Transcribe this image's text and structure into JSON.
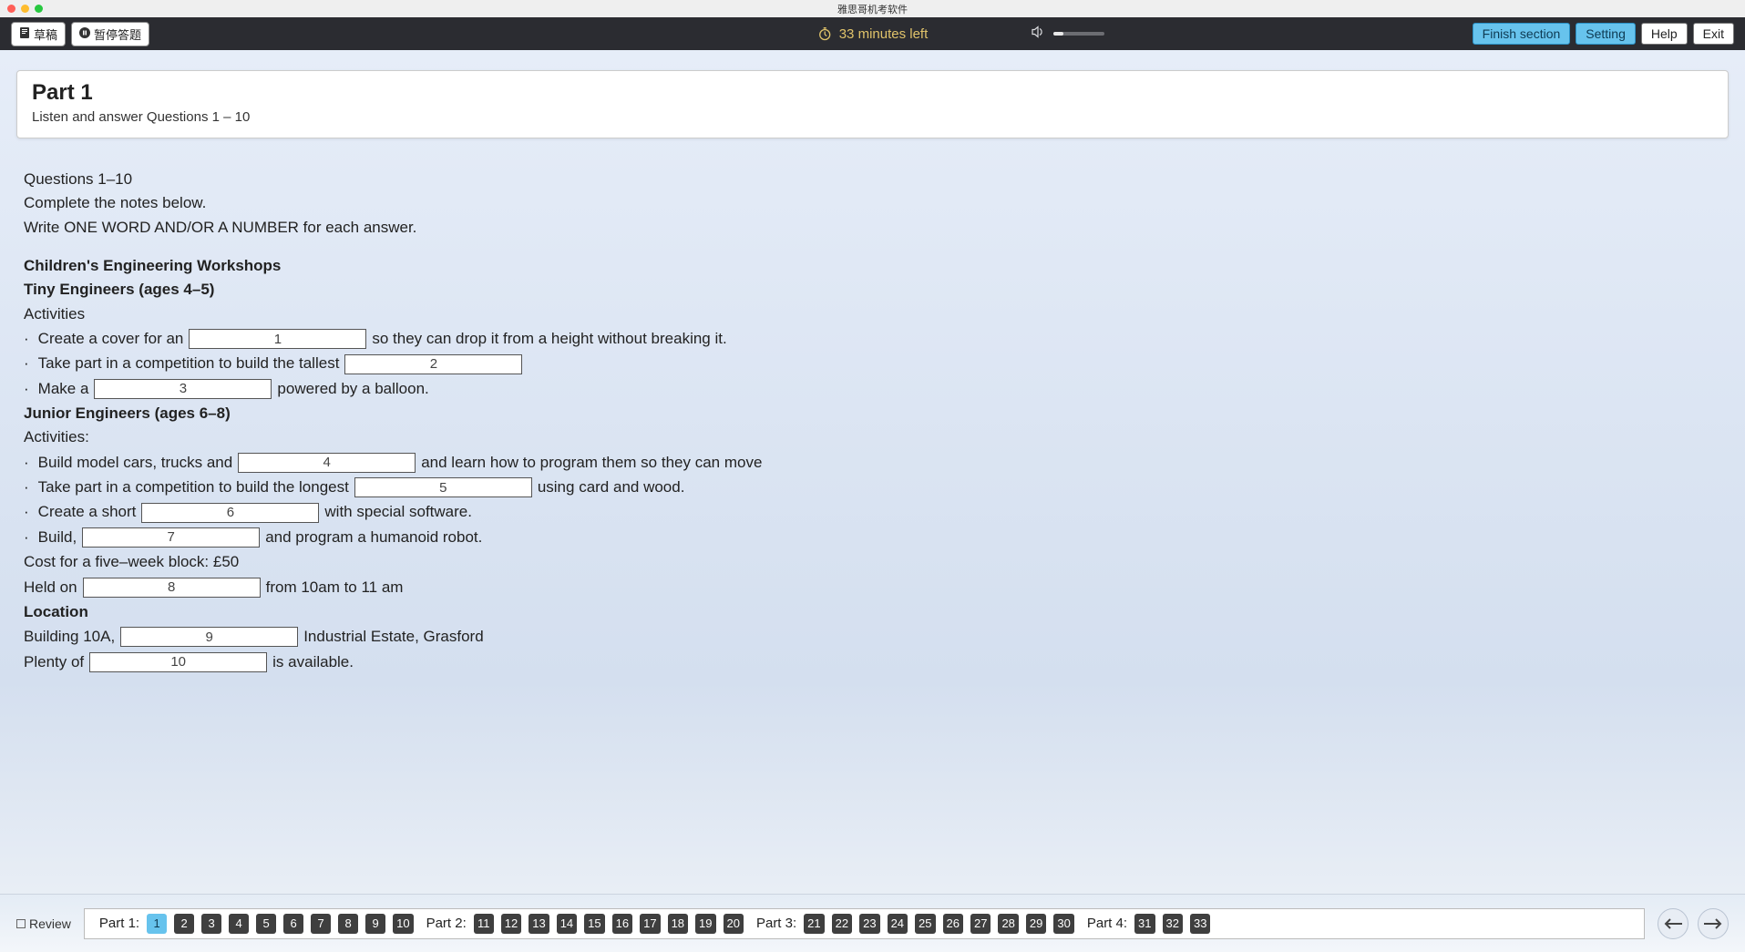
{
  "window": {
    "title": "雅思哥机考软件"
  },
  "topbar": {
    "draft_label": "草稿",
    "pause_label": "暂停答题",
    "timer_text": "33 minutes left",
    "finish_label": "Finish section",
    "setting_label": "Setting",
    "help_label": "Help",
    "exit_label": "Exit"
  },
  "header": {
    "title": "Part 1",
    "subtitle": "Listen and answer Questions 1 – 10"
  },
  "instructions": {
    "line1": "Questions 1–10",
    "line2": "Complete the notes below.",
    "line3": "Write ONE WORD AND/OR A NUMBER for each answer."
  },
  "content": {
    "heading": "Children's Engineering Workshops",
    "tiny_title": "Tiny Engineers (ages 4–5)",
    "activities_label": "Activities",
    "q1_a": "Create a cover for an",
    "q1_b": "so they can drop it from a height without breaking it.",
    "q2_a": "Take part in a competition to build the tallest",
    "q3_a": "Make a",
    "q3_b": "powered by a balloon.",
    "junior_title": "Junior Engineers (ages 6–8)",
    "activities2_label": "Activities:",
    "q4_a": "Build model cars, trucks and",
    "q4_b": "and learn how to program them so they can move",
    "q5_a": "Take part in a competition to build the longest",
    "q5_b": "using card and wood.",
    "q6_a": "Create a short",
    "q6_b": "with special software.",
    "q7_a": "Build,",
    "q7_b": "and program a humanoid robot.",
    "cost_line": "Cost for a five–week block: £50",
    "held_a": "Held on",
    "held_b": "from 10am to 11 am",
    "location_label": "Location",
    "loc_a": "Building 10A,",
    "loc_b": "Industrial Estate, Grasford",
    "plenty_a": "Plenty of",
    "plenty_b": "is available."
  },
  "blanks": {
    "1": "1",
    "2": "2",
    "3": "3",
    "4": "4",
    "5": "5",
    "6": "6",
    "7": "7",
    "8": "8",
    "9": "9",
    "10": "10"
  },
  "nav": {
    "review_label": "Review",
    "parts": [
      {
        "label": "Part 1:",
        "items": [
          "1",
          "2",
          "3",
          "4",
          "5",
          "6",
          "7",
          "8",
          "9",
          "10"
        ],
        "active": "1"
      },
      {
        "label": "Part 2:",
        "items": [
          "11",
          "12",
          "13",
          "14",
          "15",
          "16",
          "17",
          "18",
          "19",
          "20"
        ]
      },
      {
        "label": "Part 3:",
        "items": [
          "21",
          "22",
          "23",
          "24",
          "25",
          "26",
          "27",
          "28",
          "29",
          "30"
        ]
      },
      {
        "label": "Part 4:",
        "items": [
          "31",
          "32",
          "33"
        ]
      }
    ]
  }
}
